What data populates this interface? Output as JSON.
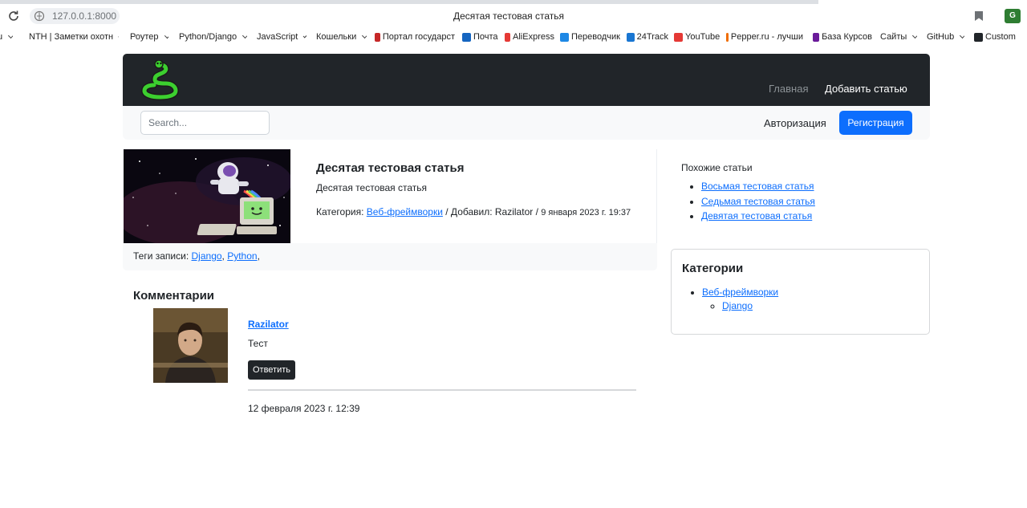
{
  "browser": {
    "url": "127.0.0.1:8000",
    "tab_title": "Десятая тестовая статья",
    "ext_label": "G",
    "bookmarks": [
      {
        "label": "u",
        "dropdown": true,
        "icon": "",
        "color": ""
      },
      {
        "label": "NTH | Заметки охотн",
        "dropdown": true,
        "icon": "",
        "color": ""
      },
      {
        "label": "Роутер",
        "dropdown": true,
        "icon": "",
        "color": ""
      },
      {
        "label": "Python/Django",
        "dropdown": true,
        "icon": "",
        "color": ""
      },
      {
        "label": "JavaScript",
        "dropdown": true,
        "icon": "",
        "color": ""
      },
      {
        "label": "Кошельки",
        "dropdown": true,
        "icon": "",
        "color": ""
      },
      {
        "label": "Портал государст",
        "dropdown": false,
        "icon": "flag-icon",
        "color": "#c62828"
      },
      {
        "label": "Почта",
        "dropdown": false,
        "icon": "mail-icon",
        "color": "#1565c0"
      },
      {
        "label": "AliExpress",
        "dropdown": false,
        "icon": "aliexpress-icon",
        "color": "#e53935"
      },
      {
        "label": "Переводчик",
        "dropdown": false,
        "icon": "translate-icon",
        "color": "#1e88e5"
      },
      {
        "label": "24Track",
        "dropdown": false,
        "icon": "track-icon",
        "color": "#1976d2"
      },
      {
        "label": "YouTube",
        "dropdown": false,
        "icon": "youtube-icon",
        "color": "#e53935"
      },
      {
        "label": "Pepper.ru - лучши",
        "dropdown": false,
        "icon": "flame-icon",
        "color": "#ef6c00"
      },
      {
        "label": "База Курсов",
        "dropdown": false,
        "icon": "courses-icon",
        "color": "#6a1b9a"
      },
      {
        "label": "Сайты",
        "dropdown": true,
        "icon": "",
        "color": ""
      },
      {
        "label": "GitHub",
        "dropdown": true,
        "icon": "",
        "color": ""
      },
      {
        "label": "Custom",
        "dropdown": false,
        "icon": "custom-icon",
        "color": "#212529"
      }
    ]
  },
  "header": {
    "nav_home": "Главная",
    "nav_add": "Добавить статью"
  },
  "subnav": {
    "search_placeholder": "Search...",
    "login": "Авторизация",
    "register": "Регистрация"
  },
  "article": {
    "title": "Десятая тестовая статья",
    "description": "Десятая тестовая статья",
    "category_label": "Категория:",
    "category": "Веб-фреймворки",
    "added_label": "/ Добавил: Razilator /",
    "date": "9 января 2023 г. 19:37",
    "tags_label": "Теги записи:",
    "tags": [
      "Django",
      "Python"
    ]
  },
  "comments": {
    "title": "Комментарии",
    "items": [
      {
        "author": "Razilator",
        "text": "Тест",
        "reply": "Ответить",
        "date": "12 февраля 2023 г. 12:39"
      }
    ]
  },
  "similar": {
    "title": "Похожие статьи",
    "items": [
      "Восьмая тестовая статья",
      "Седьмая тестовая статья",
      "Девятая тестовая статья"
    ]
  },
  "categories": {
    "title": "Категории",
    "items": [
      {
        "name": "Веб-фреймворки",
        "children": [
          "Django"
        ]
      }
    ]
  },
  "colors": {
    "accent": "#0d6efd",
    "header_bg": "#212529",
    "subnav_bg": "#f8f9fa"
  }
}
